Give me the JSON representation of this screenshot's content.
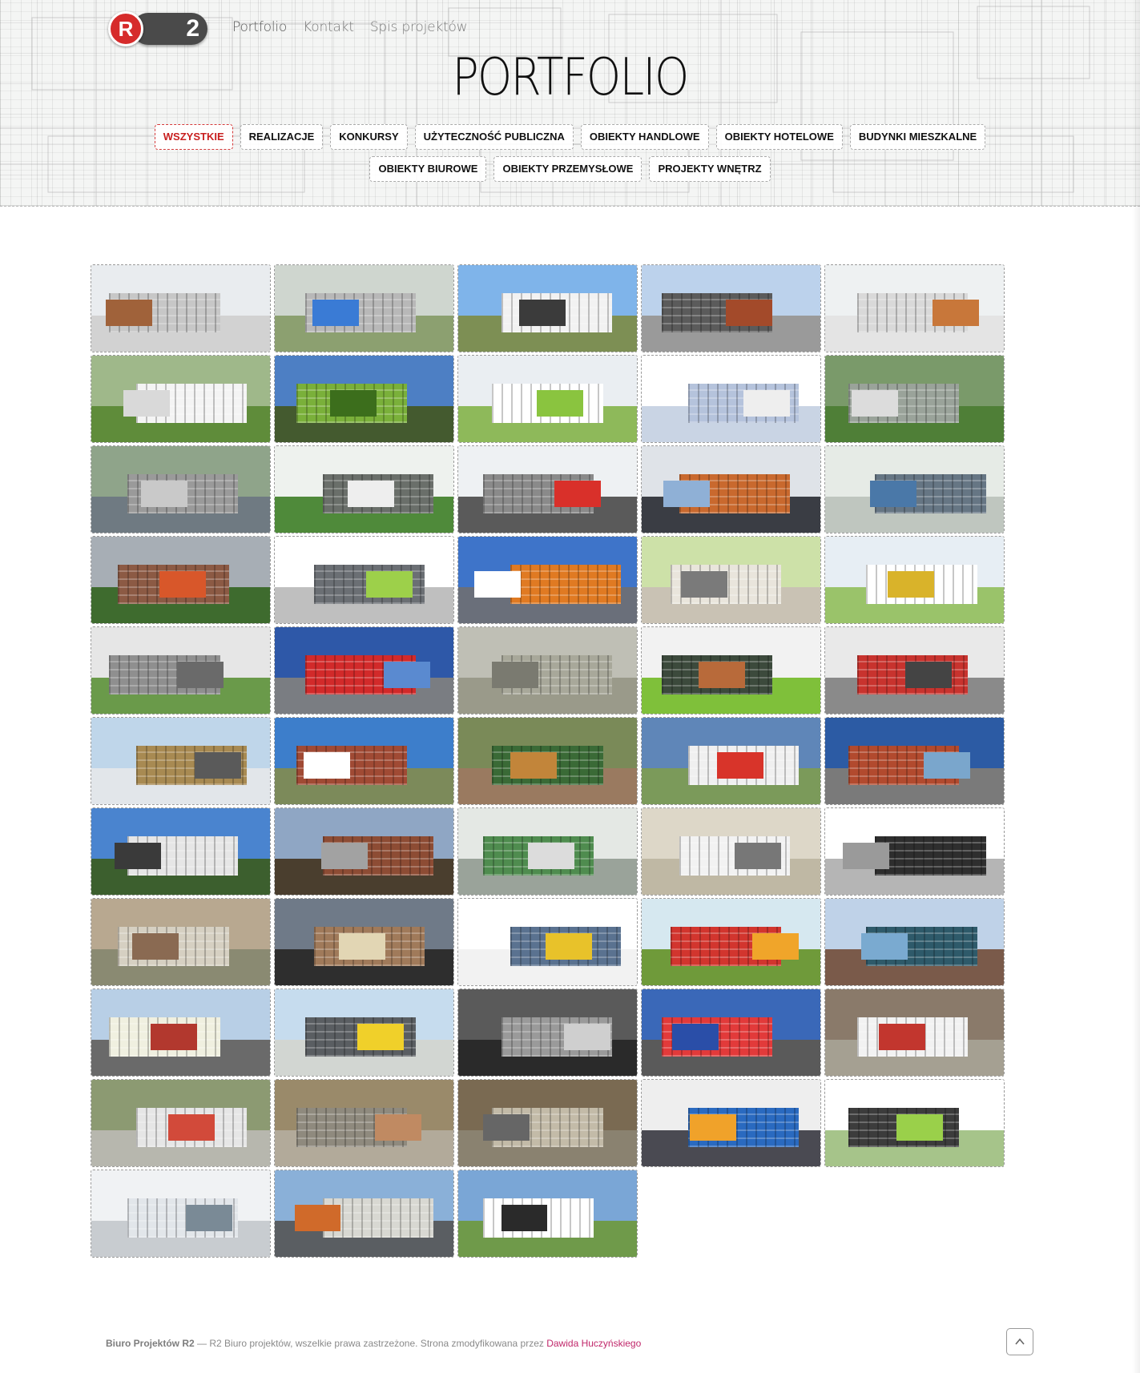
{
  "logo": {
    "letter": "R",
    "number": "2"
  },
  "topnav": [
    {
      "label": "Portfolio",
      "active": true
    },
    {
      "label": "Kontakt",
      "active": false
    },
    {
      "label": "Spis projektów",
      "active": false
    }
  ],
  "title": "PORTFOLIO",
  "filters": [
    {
      "label": "WSZYSTKIE",
      "active": true
    },
    {
      "label": "REALIZACJE",
      "active": false
    },
    {
      "label": "KONKURSY",
      "active": false
    },
    {
      "label": "UŻYTECZNOŚĆ PUBLICZNA",
      "active": false
    },
    {
      "label": "OBIEKTY HANDLOWE",
      "active": false
    },
    {
      "label": "OBIEKTY HOTELOWE",
      "active": false
    },
    {
      "label": "BUDYNKI MIESZKALNE",
      "active": false
    },
    {
      "label": "OBIEKTY BIUROWE",
      "active": false
    },
    {
      "label": "OBIEKTY PRZEMYSŁOWE",
      "active": false
    },
    {
      "label": "PROJEKTY WNĘTRZ",
      "active": false
    }
  ],
  "tiles": [
    {
      "sky": "#e9ecef",
      "ground": "#d2d2d2",
      "bldg": "#c7c7c7",
      "accent": "#a0623a"
    },
    {
      "sky": "#cfd6cf",
      "ground": "#8ca070",
      "bldg": "#b8b8b8",
      "accent": "#3a7bd5"
    },
    {
      "sky": "#7fb4ea",
      "ground": "#7d8f54",
      "bldg": "#f2f2f2",
      "accent": "#3b3b3b"
    },
    {
      "sky": "#bcd2ec",
      "ground": "#9a9a9a",
      "bldg": "#5b5b5b",
      "accent": "#a34a2a"
    },
    {
      "sky": "#eef1f2",
      "ground": "#e4e4e4",
      "bldg": "#d9d9d9",
      "accent": "#c8773a"
    },
    {
      "sky": "#9fb88a",
      "ground": "#5f8c3a",
      "bldg": "#f4f4f4",
      "accent": "#d9d9d9"
    },
    {
      "sky": "#4d7fc4",
      "ground": "#445a2f",
      "bldg": "#7ab03a",
      "accent": "#3c6e1c"
    },
    {
      "sky": "#eaeef2",
      "ground": "#8eb95a",
      "bldg": "#ffffff",
      "accent": "#8ac43f"
    },
    {
      "sky": "#ffffff",
      "ground": "#c9d4e4",
      "bldg": "#b5c3dc",
      "accent": "#eeeeee"
    },
    {
      "sky": "#7a9a6a",
      "ground": "#4f7f37",
      "bldg": "#9aa39a",
      "accent": "#dcdcdc"
    },
    {
      "sky": "#8fa48a",
      "ground": "#6f7a82",
      "bldg": "#9a9a9a",
      "accent": "#c9c9c9"
    },
    {
      "sky": "#eef2ee",
      "ground": "#4f8a3a",
      "bldg": "#6a6f6a",
      "accent": "#eeeeee"
    },
    {
      "sky": "#eef1f3",
      "ground": "#5a5a5a",
      "bldg": "#8a8a8a",
      "accent": "#d9302a"
    },
    {
      "sky": "#dfe3e8",
      "ground": "#3a3d44",
      "bldg": "#c9692e",
      "accent": "#8fb0d6"
    },
    {
      "sky": "#e6ebe6",
      "ground": "#bfc6bf",
      "bldg": "#667684",
      "accent": "#4a78a8"
    },
    {
      "sky": "#a7aeb5",
      "ground": "#3e6b2e",
      "bldg": "#8c5a44",
      "accent": "#d8572a"
    },
    {
      "sky": "#ffffff",
      "ground": "#bfbfbf",
      "bldg": "#6b6f74",
      "accent": "#9dd04a"
    },
    {
      "sky": "#3e74c9",
      "ground": "#6a6f7a",
      "bldg": "#e07a22",
      "accent": "#ffffff"
    },
    {
      "sky": "#cde1a8",
      "ground": "#c9c2b4",
      "bldg": "#e9e5dc",
      "accent": "#7a7a7a"
    },
    {
      "sky": "#e7eef4",
      "ground": "#9ac36a",
      "bldg": "#ffffff",
      "accent": "#d9b32a"
    },
    {
      "sky": "#e6e6e6",
      "ground": "#6a9a4a",
      "bldg": "#8f8f8f",
      "accent": "#6a6a6a"
    },
    {
      "sky": "#2e58a8",
      "ground": "#7a7d82",
      "bldg": "#d22a2a",
      "accent": "#5a8ad0"
    },
    {
      "sky": "#bfbfb5",
      "ground": "#9a9a8a",
      "bldg": "#a8a89a",
      "accent": "#7a7a70"
    },
    {
      "sky": "#f2f2f2",
      "ground": "#7fc03a",
      "bldg": "#3c4a3c",
      "accent": "#b86a3a"
    },
    {
      "sky": "#e9e9e9",
      "ground": "#8a8a8a",
      "bldg": "#c8332e",
      "accent": "#444444"
    },
    {
      "sky": "#bfd6ea",
      "ground": "#e2e6ea",
      "bldg": "#a88a52",
      "accent": "#5a5a5a"
    },
    {
      "sky": "#3d7ecb",
      "ground": "#7c8a5a",
      "bldg": "#a04a34",
      "accent": "#ffffff"
    },
    {
      "sky": "#7a8a58",
      "ground": "#9a7a60",
      "bldg": "#3a6a36",
      "accent": "#c2853a"
    },
    {
      "sky": "#5f86b8",
      "ground": "#7b9a5a",
      "bldg": "#f0f0f0",
      "accent": "#d8342a"
    },
    {
      "sky": "#2c5ba4",
      "ground": "#7a7a7a",
      "bldg": "#b24a2e",
      "accent": "#7aa6cc"
    },
    {
      "sky": "#4a84cf",
      "ground": "#3c5f2e",
      "bldg": "#e6e6e6",
      "accent": "#3a3a3a"
    },
    {
      "sky": "#8fa6c4",
      "ground": "#4a3e2e",
      "bldg": "#8d4c34",
      "accent": "#a2a2a2"
    },
    {
      "sky": "#e4e8e4",
      "ground": "#9aa39a",
      "bldg": "#4f8c4f",
      "accent": "#dcdcdc"
    },
    {
      "sky": "#ddd7c8",
      "ground": "#bfb8a4",
      "bldg": "#f2f2f2",
      "accent": "#777777"
    },
    {
      "sky": "#ffffff",
      "ground": "#b5b5b5",
      "bldg": "#2e2e2e",
      "accent": "#9a9a9a"
    },
    {
      "sky": "#b8a890",
      "ground": "#8a8a72",
      "bldg": "#d6d0c2",
      "accent": "#8a6a52"
    },
    {
      "sky": "#6f7a88",
      "ground": "#2e2e2e",
      "bldg": "#a07a5a",
      "accent": "#e2d6b4"
    },
    {
      "sky": "#ffffff",
      "ground": "#f2f2f2",
      "bldg": "#5a7290",
      "accent": "#e8c22a"
    },
    {
      "sky": "#d6e8f0",
      "ground": "#6f9a3a",
      "bldg": "#d2352e",
      "accent": "#f0a52a"
    },
    {
      "sky": "#bfd2e8",
      "ground": "#7a5a4a",
      "bldg": "#2e5a6a",
      "accent": "#7aaad0"
    },
    {
      "sky": "#b8cfe6",
      "ground": "#6a6a6a",
      "bldg": "#f0f0e0",
      "accent": "#b2382e"
    },
    {
      "sky": "#c6dcee",
      "ground": "#d2d6d2",
      "bldg": "#5a5e62",
      "accent": "#f0d02a"
    },
    {
      "sky": "#5a5a5a",
      "ground": "#2a2a2a",
      "bldg": "#9a9a9a",
      "accent": "#cfcfcf"
    },
    {
      "sky": "#3a68b8",
      "ground": "#5a5a5a",
      "bldg": "#e23a3a",
      "accent": "#2a4ea8"
    },
    {
      "sky": "#8a7a6a",
      "ground": "#a5a092",
      "bldg": "#f2f2f2",
      "accent": "#c2362e"
    },
    {
      "sky": "#8c9a72",
      "ground": "#b7b7ae",
      "bldg": "#e6e6e6",
      "accent": "#d24a3a"
    },
    {
      "sky": "#9a8a6a",
      "ground": "#b2aa9a",
      "bldg": "#8f8a7e",
      "accent": "#c08a62"
    },
    {
      "sky": "#7a6a52",
      "ground": "#8a8270",
      "bldg": "#c3bba8",
      "accent": "#666666"
    },
    {
      "sky": "#eeeeee",
      "ground": "#4a4a52",
      "bldg": "#2a6ac0",
      "accent": "#f0a22a"
    },
    {
      "sky": "#ffffff",
      "ground": "#a6c48a",
      "bldg": "#3c3c3c",
      "accent": "#9ad04a"
    },
    {
      "sky": "#f0f2f4",
      "ground": "#c8ccd0",
      "bldg": "#e2e6ea",
      "accent": "#7a8a96"
    },
    {
      "sky": "#8ab0d8",
      "ground": "#5a5e62",
      "bldg": "#d8d8d2",
      "accent": "#d06a2a"
    },
    {
      "sky": "#7aa6d6",
      "ground": "#6f9a4a",
      "bldg": "#ffffff",
      "accent": "#2a2a2a"
    }
  ],
  "footer": {
    "brand": "Biuro Projektów R2",
    "dash": " — ",
    "text": "R2 Biuro projektów, wszelkie prawa zastrzeżone. Strona zmodyfikowana przez ",
    "author": "Dawida Huczyńskiego"
  },
  "icons": {
    "back_to_top": "chevron-up-icon"
  }
}
